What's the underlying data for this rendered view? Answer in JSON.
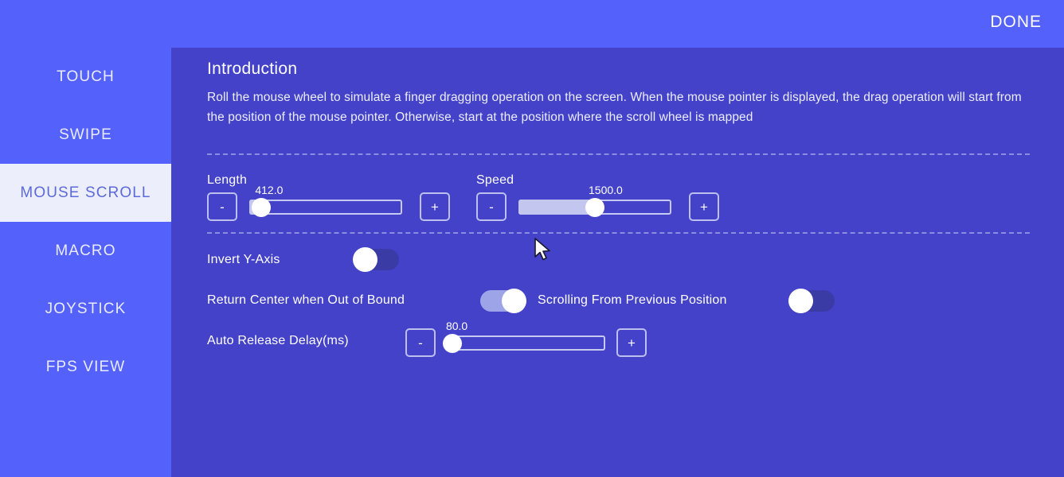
{
  "topbar": {
    "done_label": "DONE"
  },
  "sidebar": {
    "items": [
      {
        "label": "TOUCH",
        "active": false
      },
      {
        "label": "SWIPE",
        "active": false
      },
      {
        "label": "MOUSE SCROLL",
        "active": true
      },
      {
        "label": "MACRO",
        "active": false
      },
      {
        "label": "JOYSTICK",
        "active": false
      },
      {
        "label": "FPS VIEW",
        "active": false
      }
    ]
  },
  "panel": {
    "intro_title": "Introduction",
    "intro_body": "Roll the mouse wheel to simulate a finger dragging operation on the screen. When the mouse pointer is displayed, the drag operation will start from the position of the mouse pointer. Otherwise, start at the position where the scroll wheel is mapped",
    "sliders": [
      {
        "label": "Length",
        "value": "412.0",
        "minus_label": "-",
        "plus_label": "+",
        "percent": 8
      },
      {
        "label": "Speed",
        "value": "1500.0",
        "minus_label": "-",
        "plus_label": "+",
        "percent": 50
      }
    ],
    "toggles": [
      {
        "label": "Invert Y-Axis",
        "state": "off"
      },
      {
        "label": "Return Center when Out of Bound",
        "state": "on"
      },
      {
        "label": "Scrolling From Previous Position",
        "state": "off"
      }
    ],
    "delay": {
      "label": "Auto Release Delay(ms)",
      "value": "80.0",
      "minus_label": "-",
      "plus_label": "+",
      "percent": 3
    }
  },
  "colors": {
    "sidebar_bg": "#5561fb",
    "panel_bg": "#4342c8",
    "active_nav_bg": "#eceefc",
    "accent_light": "#c3c6ef"
  }
}
